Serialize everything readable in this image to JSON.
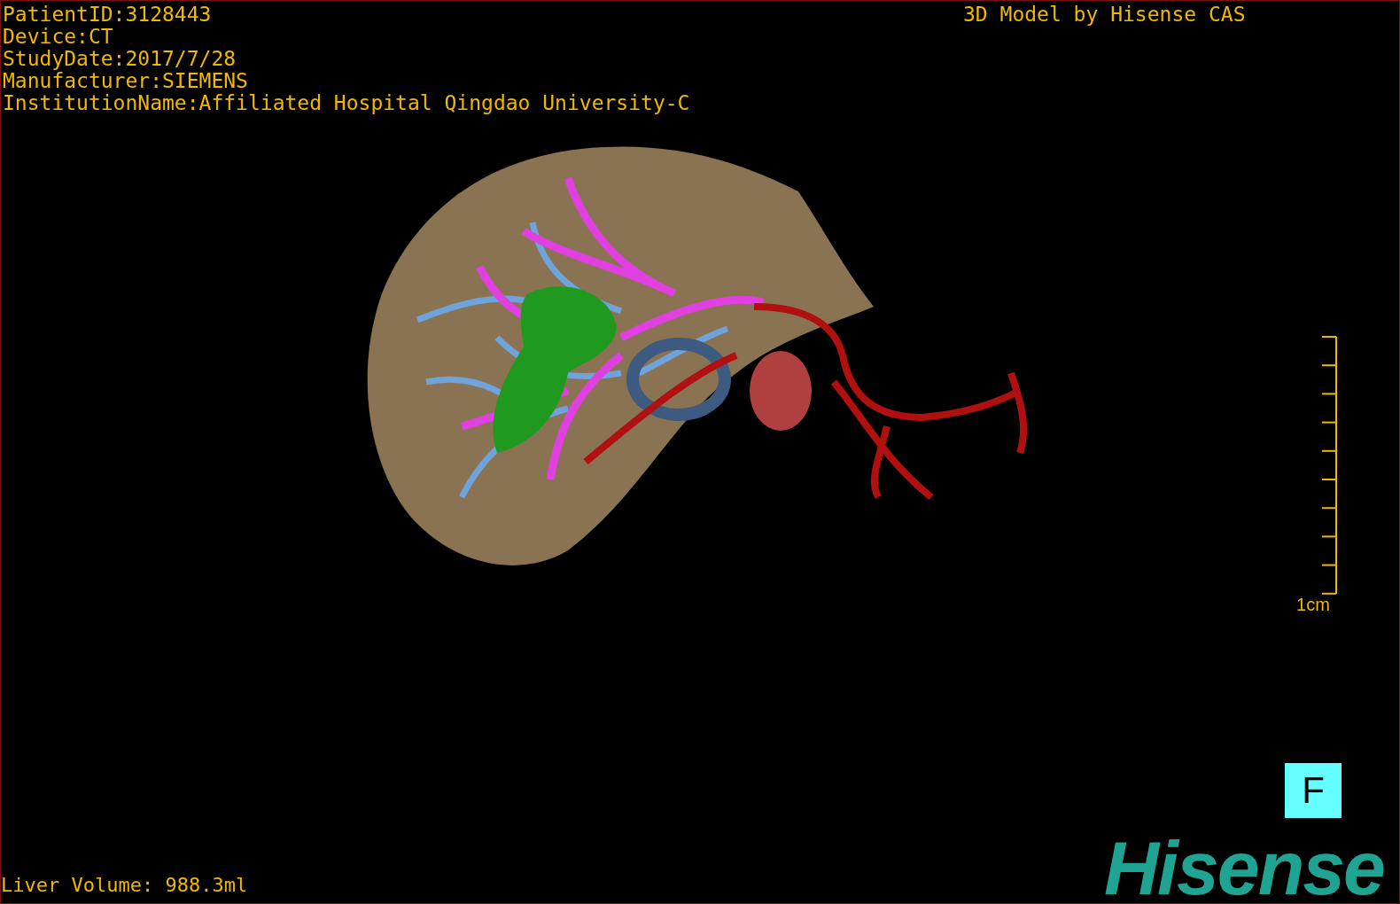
{
  "patient_info": [
    "PatientID:3128443",
    "Device:CT",
    "StudyDate:2017/7/28",
    "Manufacturer:SIEMENS",
    "InstitutionName:Affiliated Hospital Qingdao University-C"
  ],
  "model_credit": "3D Model by Hisense CAS",
  "scale_bar": {
    "label": "1cm"
  },
  "orientation_label": "F",
  "liver_volume": "Liver Volume: 988.3ml",
  "logo": "Hisense"
}
